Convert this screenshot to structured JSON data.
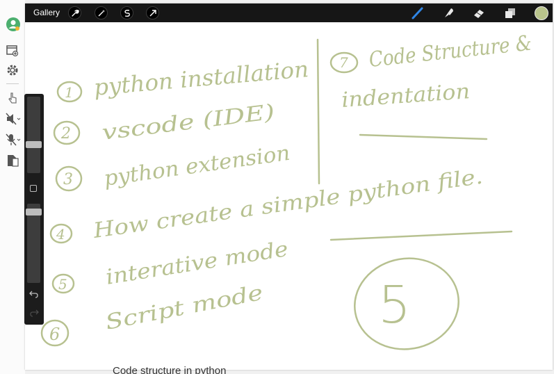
{
  "toolbar": {
    "gallery_label": "Gallery",
    "left_tools": [
      "wrench-icon",
      "magic-wand-icon",
      "selection-icon",
      "transform-arrow-icon"
    ],
    "right_tools": [
      "brush-icon",
      "smudge-icon",
      "eraser-icon",
      "layers-icon"
    ],
    "current_color": "#b9c48c"
  },
  "sidebar": {
    "controls": [
      "brush-size-slider",
      "modify-button",
      "opacity-slider",
      "undo-button",
      "redo-button"
    ]
  },
  "canvas": {
    "ink_color": "#b7c190",
    "handwriting": {
      "item1": "python installation",
      "item2": "vscode (IDE)",
      "item3": "python extension",
      "item4": "How create a simple python file.",
      "item5": "interative mode",
      "item6": "Script mode",
      "item7a": "Code Structure &",
      "item7b": "indentation",
      "big_number": "5",
      "n1": "1",
      "n2": "2",
      "n3": "3",
      "n4": "4",
      "n5": "5",
      "n6": "6",
      "n7": "7"
    }
  },
  "caption": "Code structure in python"
}
